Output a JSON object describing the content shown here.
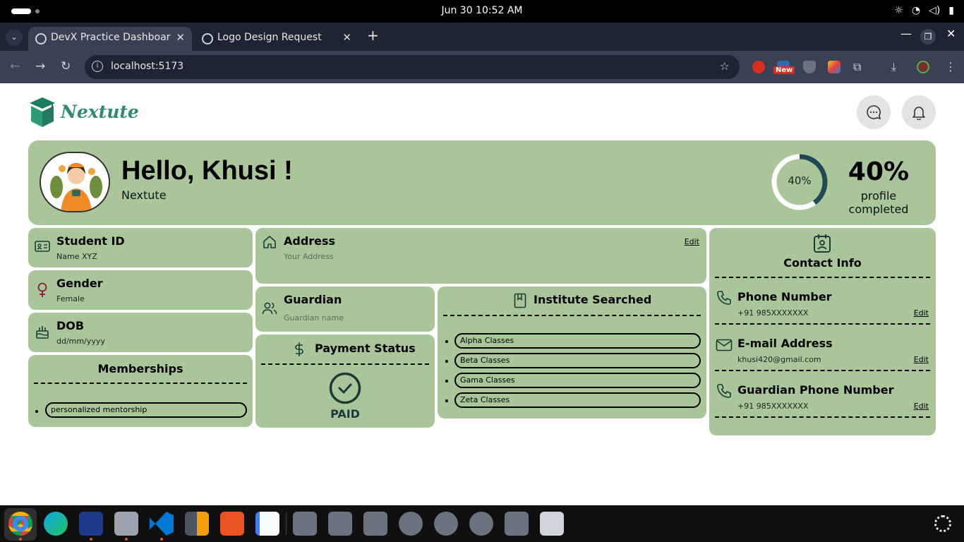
{
  "os": {
    "clock": "Jun 30  10:52 AM"
  },
  "browser": {
    "tabs": [
      {
        "title": "DevX Practice Dashboard",
        "active": true
      },
      {
        "title": "Logo Design Request",
        "active": false
      }
    ],
    "url": "localhost:5173",
    "extension_badge": "New"
  },
  "app": {
    "brand": "Nextute",
    "header_icons": [
      "chat-icon",
      "bell-icon"
    ]
  },
  "hero": {
    "greeting": "Hello, Khusi !",
    "subtitle": "Nextute",
    "ring_label": "40%",
    "progress": 0.4,
    "percent_text": "40%",
    "percent_caption": "profile completed"
  },
  "student_id": {
    "title": "Student ID",
    "value": "Name XYZ"
  },
  "gender": {
    "title": "Gender",
    "value": "Female"
  },
  "dob": {
    "title": "DOB",
    "value": "dd/mm/yyyy"
  },
  "memberships": {
    "title": "Memberships",
    "items": [
      "personalized mentorship"
    ]
  },
  "address": {
    "title": "Address",
    "placeholder": "Your Address",
    "edit": "Edit"
  },
  "guardian": {
    "title": "Guardian",
    "placeholder": "Guardian name"
  },
  "payment": {
    "title": "Payment Status",
    "status": "PAID"
  },
  "institutes": {
    "title": "Institute Searched",
    "items": [
      "Alpha Classes",
      "Beta Classes",
      "Gama Classes",
      "Zeta Classes"
    ]
  },
  "contact": {
    "title": "Contact Info",
    "phone": {
      "title": "Phone Number",
      "value": "+91 985XXXXXXX",
      "edit": "Edit"
    },
    "email": {
      "title": "E-mail Address",
      "value": "khusi420@gmail.com",
      "edit": "Edit"
    },
    "guardian_phone": {
      "title": "Guardian Phone Number",
      "value": "+91 985XXXXXXX",
      "edit": "Edit"
    }
  },
  "colors": {
    "card": "#a8c69a",
    "ring": "#1f4a52",
    "brand": "#2e8b73",
    "gender_icon": "#8b1a3a"
  }
}
